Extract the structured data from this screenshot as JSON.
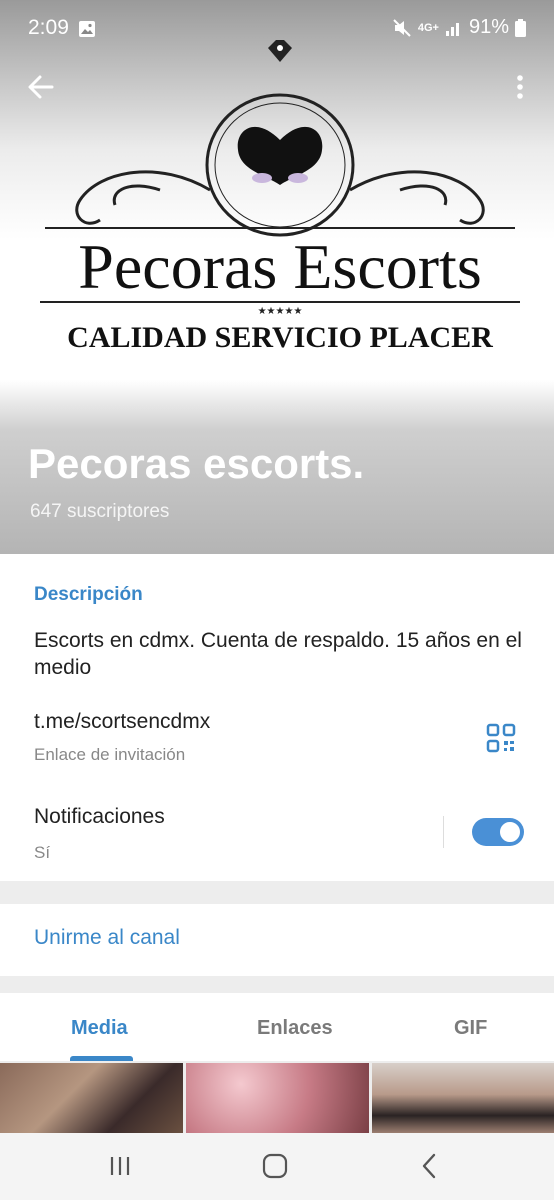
{
  "status_bar": {
    "time": "2:09",
    "network": "4G+",
    "battery": "91%"
  },
  "channel": {
    "logo_title": "Pecoras Escorts",
    "logo_tagline": "CALIDAD SERVICIO PLACER",
    "name": "Pecoras escorts.",
    "subscribers": "647 suscriptores"
  },
  "info": {
    "description_header": "Descripción",
    "description": "Escorts en cdmx. Cuenta de respaldo. 15 años en el medio",
    "link": "t.me/scortsencdmx",
    "link_label": "Enlace de invitación",
    "notifications_label": "Notificaciones",
    "notifications_value": "Sí"
  },
  "join_label": "Unirme al canal",
  "tabs": [
    "Media",
    "Enlaces",
    "GIF"
  ],
  "colors": {
    "accent": "#3a87c8",
    "toggle": "#4a90d6"
  }
}
